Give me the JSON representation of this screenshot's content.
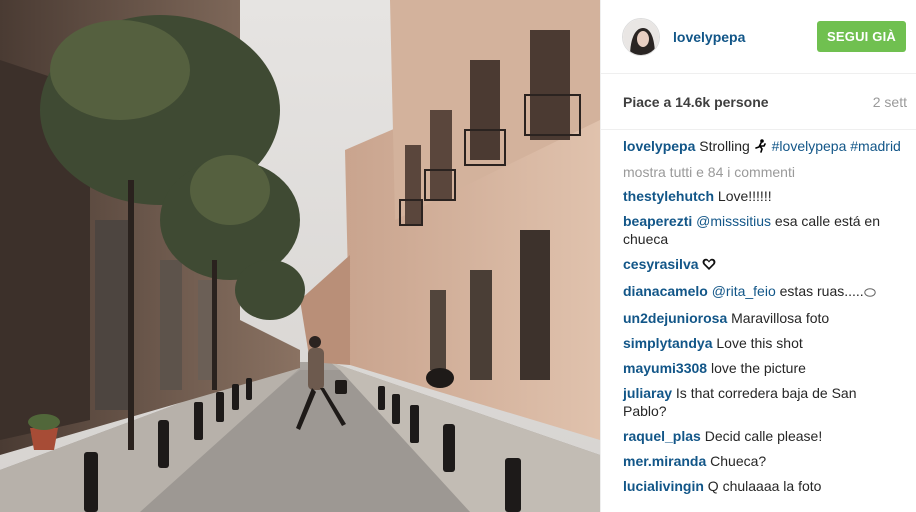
{
  "post": {
    "username": "lovelypepa",
    "follow_label": "SEGUI GIÀ",
    "likes": "Piace a 14.6k persone",
    "time": "2 sett",
    "caption": {
      "user": "lovelypepa",
      "text": "Strolling",
      "tags": [
        "#lovelypepa",
        "#madrid"
      ]
    },
    "more_comments": "mostra tutti e 84 i commenti",
    "comments": [
      {
        "user": "thestylehutch",
        "text": "Love!!!!!!"
      },
      {
        "user": "beaperezti",
        "mention": "@misssitius",
        "text": "esa calle está en chueca"
      },
      {
        "user": "cesyrasilva",
        "text": ""
      },
      {
        "user": "dianacamelo",
        "mention": "@rita_feio",
        "text": "estas ruas....."
      },
      {
        "user": "un2dejuniorosa",
        "text": "Maravillosa foto"
      },
      {
        "user": "simplytandya",
        "text": "Love this shot"
      },
      {
        "user": "mayumi3308",
        "text": "love the picture"
      },
      {
        "user": "juliaray",
        "text": "Is that corredera baja de San Pablo?"
      },
      {
        "user": "raquel_plas",
        "text": "Decid calle please!"
      },
      {
        "user": "mer.miranda",
        "text": "Chueca?"
      },
      {
        "user": "lucialivingin",
        "text": "Q chulaaaa la foto"
      }
    ]
  },
  "colors": {
    "link": "#125688",
    "follow_bg": "#70c050",
    "muted": "#9a9a9a"
  },
  "icons": [
    "avatar-photo",
    "runner-emoji-icon",
    "heart-emoji-icon",
    "speech-emoji-icon"
  ]
}
